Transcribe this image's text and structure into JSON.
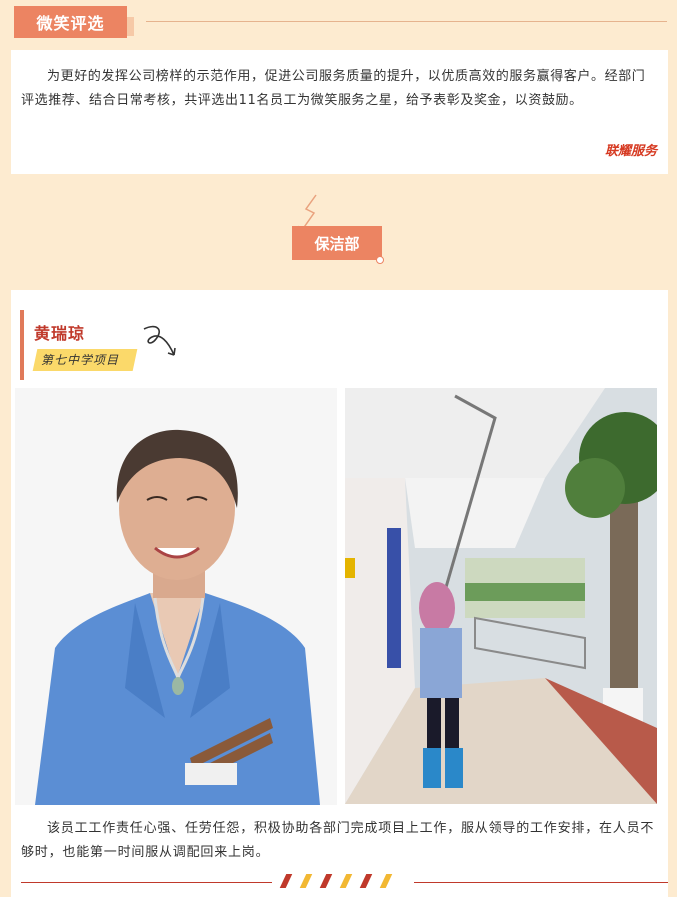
{
  "section": {
    "title": "微笑评选"
  },
  "intro": {
    "text": "为更好的发挥公司榜样的示范作用，促进公司服务质量的提升，以优质高效的服务赢得客户。经部门评选推荐、结合日常考核，共评选出11名员工为微笑服务之星，给予表彰及奖金，以资鼓励。",
    "signature": "联耀服务"
  },
  "department": {
    "label": "保洁部"
  },
  "staff": {
    "name": "黄瑞琼",
    "project": "第七中学项目",
    "description": "该员工工作责任心强、任劳任怨，积极协助各部门完成项目上工作，服从领导的工作安排，在人员不够时，也能第一时间服从调配回来上岗。"
  },
  "colors": {
    "accent": "#ec8462",
    "name_red": "#c0392b",
    "tag_yellow": "#fbd96a",
    "background": "#fdebd0"
  },
  "icons": [
    "swirl-arrow-icon",
    "lightning-deco-icon"
  ]
}
